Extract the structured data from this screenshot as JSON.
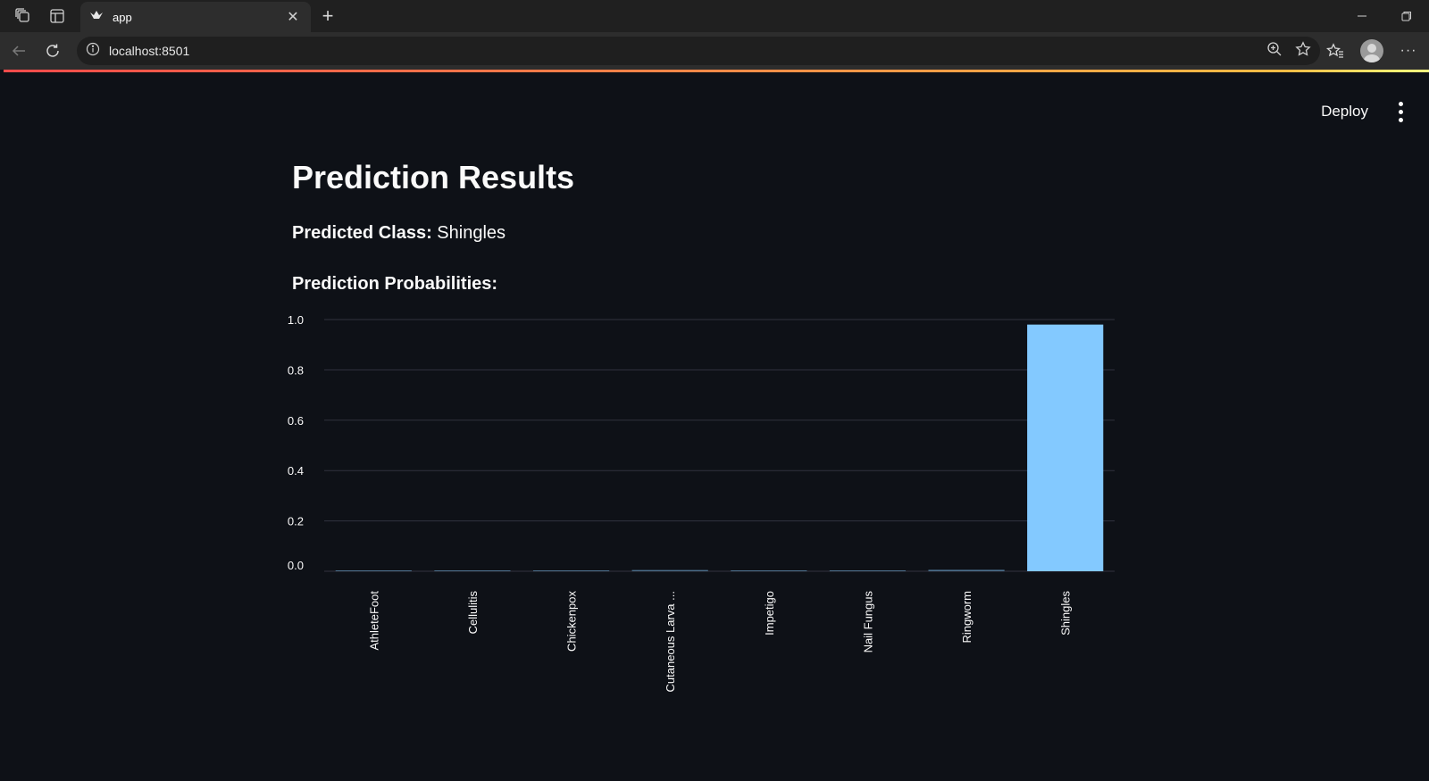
{
  "browser": {
    "tab_title": "app",
    "url": "localhost:8501"
  },
  "header": {
    "deploy_label": "Deploy"
  },
  "main": {
    "title": "Prediction Results",
    "predicted_label": "Predicted Class:",
    "predicted_value": "Shingles",
    "probabilities_label": "Prediction Probabilities:"
  },
  "colors": {
    "background": "#0e1117",
    "bar": "#83c9ff",
    "text": "#fafafa"
  },
  "chart_data": {
    "type": "bar",
    "categories": [
      "AthleteFoot",
      "Cellulitis",
      "Chickenpox",
      "Cutaneous Larva ...",
      "Impetigo",
      "Nail Fungus",
      "Ringworm",
      "Shingles"
    ],
    "values": [
      0.001,
      0.002,
      0.001,
      0.005,
      0.003,
      0.002,
      0.006,
      0.98
    ],
    "ylim": [
      0,
      1.0
    ],
    "yticks": [
      "0.0",
      "0.2",
      "0.4",
      "0.6",
      "0.8",
      "1.0"
    ],
    "grid": true,
    "xlabel": "",
    "ylabel": ""
  }
}
